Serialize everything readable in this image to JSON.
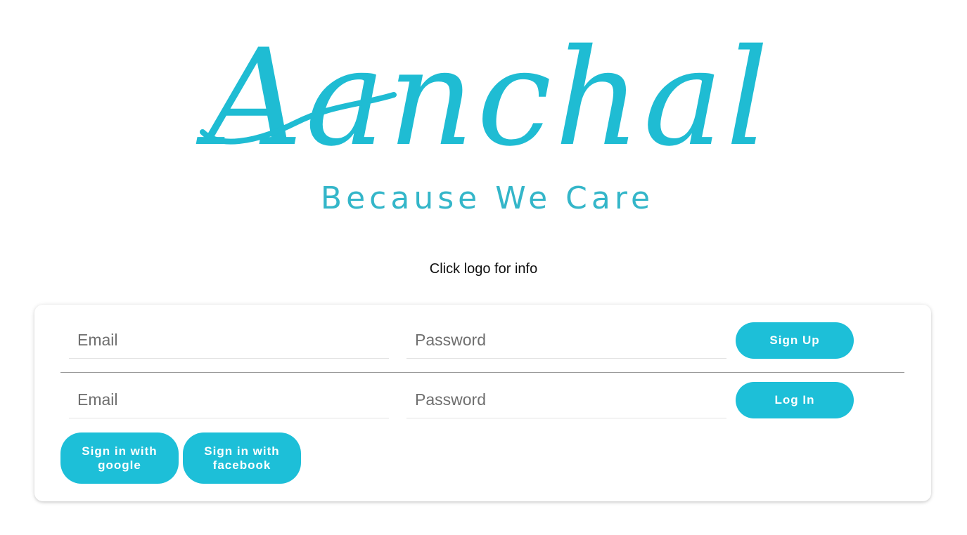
{
  "logo": {
    "script_text": "Aanchal",
    "tagline": "Because We Care",
    "color": "#1fbcd3",
    "tagline_color": "#34b6c9"
  },
  "info_text": "Click logo for info",
  "signup": {
    "email_placeholder": "Email",
    "password_placeholder": "Password",
    "button_label": "Sign Up"
  },
  "login": {
    "email_placeholder": "Email",
    "password_placeholder": "Password",
    "button_label": "Log In"
  },
  "social": {
    "google_label": "Sign in with google",
    "facebook_label": "Sign in with facebook"
  },
  "colors": {
    "accent": "#1dbfd8"
  }
}
